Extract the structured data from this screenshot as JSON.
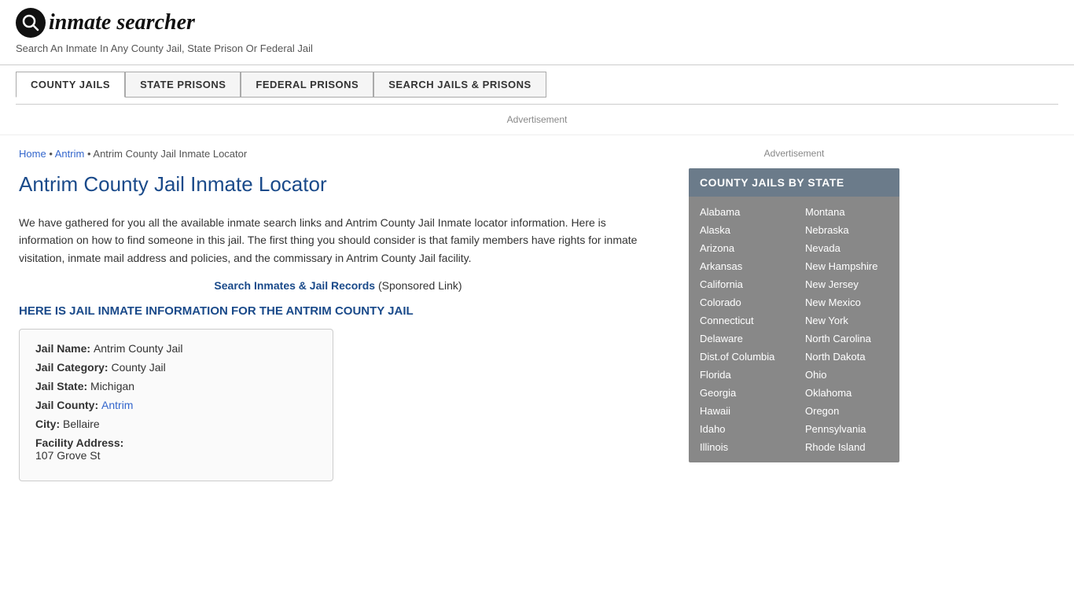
{
  "header": {
    "logo_icon": "🔍",
    "logo_text_inmate": "inmate",
    "logo_text_searcher": "searcher",
    "tagline": "Search An Inmate In Any County Jail, State Prison Or Federal Jail"
  },
  "nav": {
    "buttons": [
      {
        "label": "COUNTY JAILS",
        "active": true
      },
      {
        "label": "STATE PRISONS",
        "active": false
      },
      {
        "label": "FEDERAL PRISONS",
        "active": false
      },
      {
        "label": "SEARCH JAILS & PRISONS",
        "active": false
      }
    ]
  },
  "ad": {
    "label": "Advertisement"
  },
  "breadcrumb": {
    "home": "Home",
    "antrim": "Antrim",
    "current": "Antrim County Jail Inmate Locator"
  },
  "main": {
    "page_title": "Antrim County Jail Inmate Locator",
    "body_text": "We have gathered for you all the available inmate search links and Antrim County Jail Inmate locator information. Here is information on how to find someone in this jail. The first thing you should consider is that family members have rights for inmate visitation, inmate mail address and policies, and the commissary in Antrim County Jail facility.",
    "sponsored_link_text": "Search Inmates & Jail Records",
    "sponsored_note": "(Sponsored Link)",
    "jail_info_header": "HERE IS JAIL INMATE INFORMATION FOR THE ANTRIM COUNTY JAIL",
    "info": {
      "jail_name_label": "Jail Name:",
      "jail_name_value": "Antrim County Jail",
      "jail_category_label": "Jail Category:",
      "jail_category_value": "County Jail",
      "jail_state_label": "Jail State:",
      "jail_state_value": "Michigan",
      "jail_county_label": "Jail County:",
      "jail_county_value": "Antrim",
      "city_label": "City:",
      "city_value": "Bellaire",
      "facility_address_label": "Facility Address:",
      "facility_address_value": "107 Grove St"
    }
  },
  "sidebar": {
    "ad_label": "Advertisement",
    "county_jails_title": "COUNTY JAILS BY STATE",
    "states_left": [
      "Alabama",
      "Alaska",
      "Arizona",
      "Arkansas",
      "California",
      "Colorado",
      "Connecticut",
      "Delaware",
      "Dist.of Columbia",
      "Florida",
      "Georgia",
      "Hawaii",
      "Idaho",
      "Illinois"
    ],
    "states_right": [
      "Montana",
      "Nebraska",
      "Nevada",
      "New Hampshire",
      "New Jersey",
      "New Mexico",
      "New York",
      "North Carolina",
      "North Dakota",
      "Ohio",
      "Oklahoma",
      "Oregon",
      "Pennsylvania",
      "Rhode Island"
    ]
  }
}
